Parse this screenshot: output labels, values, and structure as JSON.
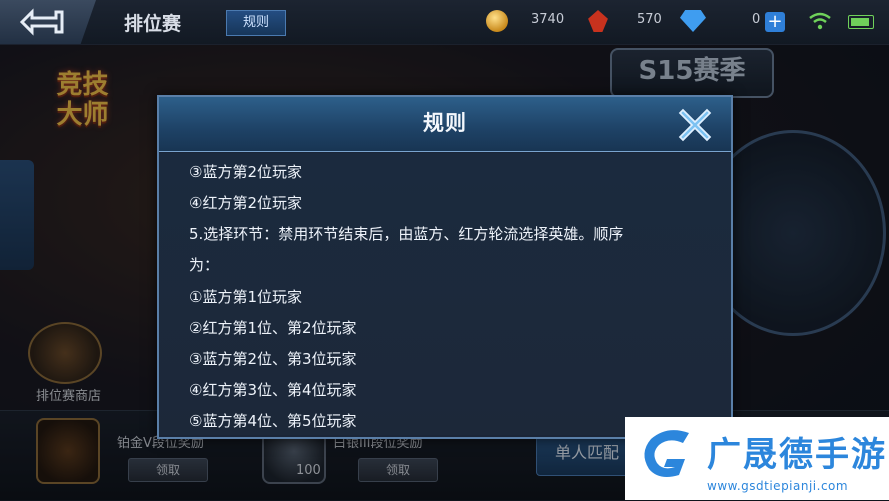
{
  "header": {
    "title": "排位赛",
    "rules_tab": "规则",
    "gold": "3740",
    "shards": "570",
    "diamonds": "0",
    "plus": "+"
  },
  "background": {
    "rank_title_line1": "竞技",
    "rank_title_line2": "大师",
    "season_logo": "S15赛季",
    "shop_label": "排位赛商店",
    "reward_left_label": "铂金V段位奖励",
    "reward_mid_label": "白银III段位奖励",
    "claim_label": "领取",
    "reward_count": "100",
    "solo_match": "单人匹配"
  },
  "modal": {
    "title": "规则",
    "lines": [
      "③蓝方第2位玩家",
      "④红方第2位玩家",
      "5.选择环节：禁用环节结束后，由蓝方、红方轮流选择英雄。顺序",
      "为：",
      "①蓝方第1位玩家",
      "②红方第1位、第2位玩家",
      "③蓝方第2位、第3位玩家",
      "④红方第3位、第4位玩家",
      "⑤蓝方第4位、第5位玩家"
    ]
  },
  "watermark": {
    "name": "广晟德手游",
    "url": "www.gsdtiepianji.com"
  },
  "colors": {
    "accent": "#2c86dc",
    "modal_border": "#5a7fa8"
  },
  "icons": [
    "back-arrow-icon",
    "gold-coin-icon",
    "shard-icon",
    "diamond-icon",
    "wifi-icon",
    "battery-icon",
    "close-icon"
  ]
}
